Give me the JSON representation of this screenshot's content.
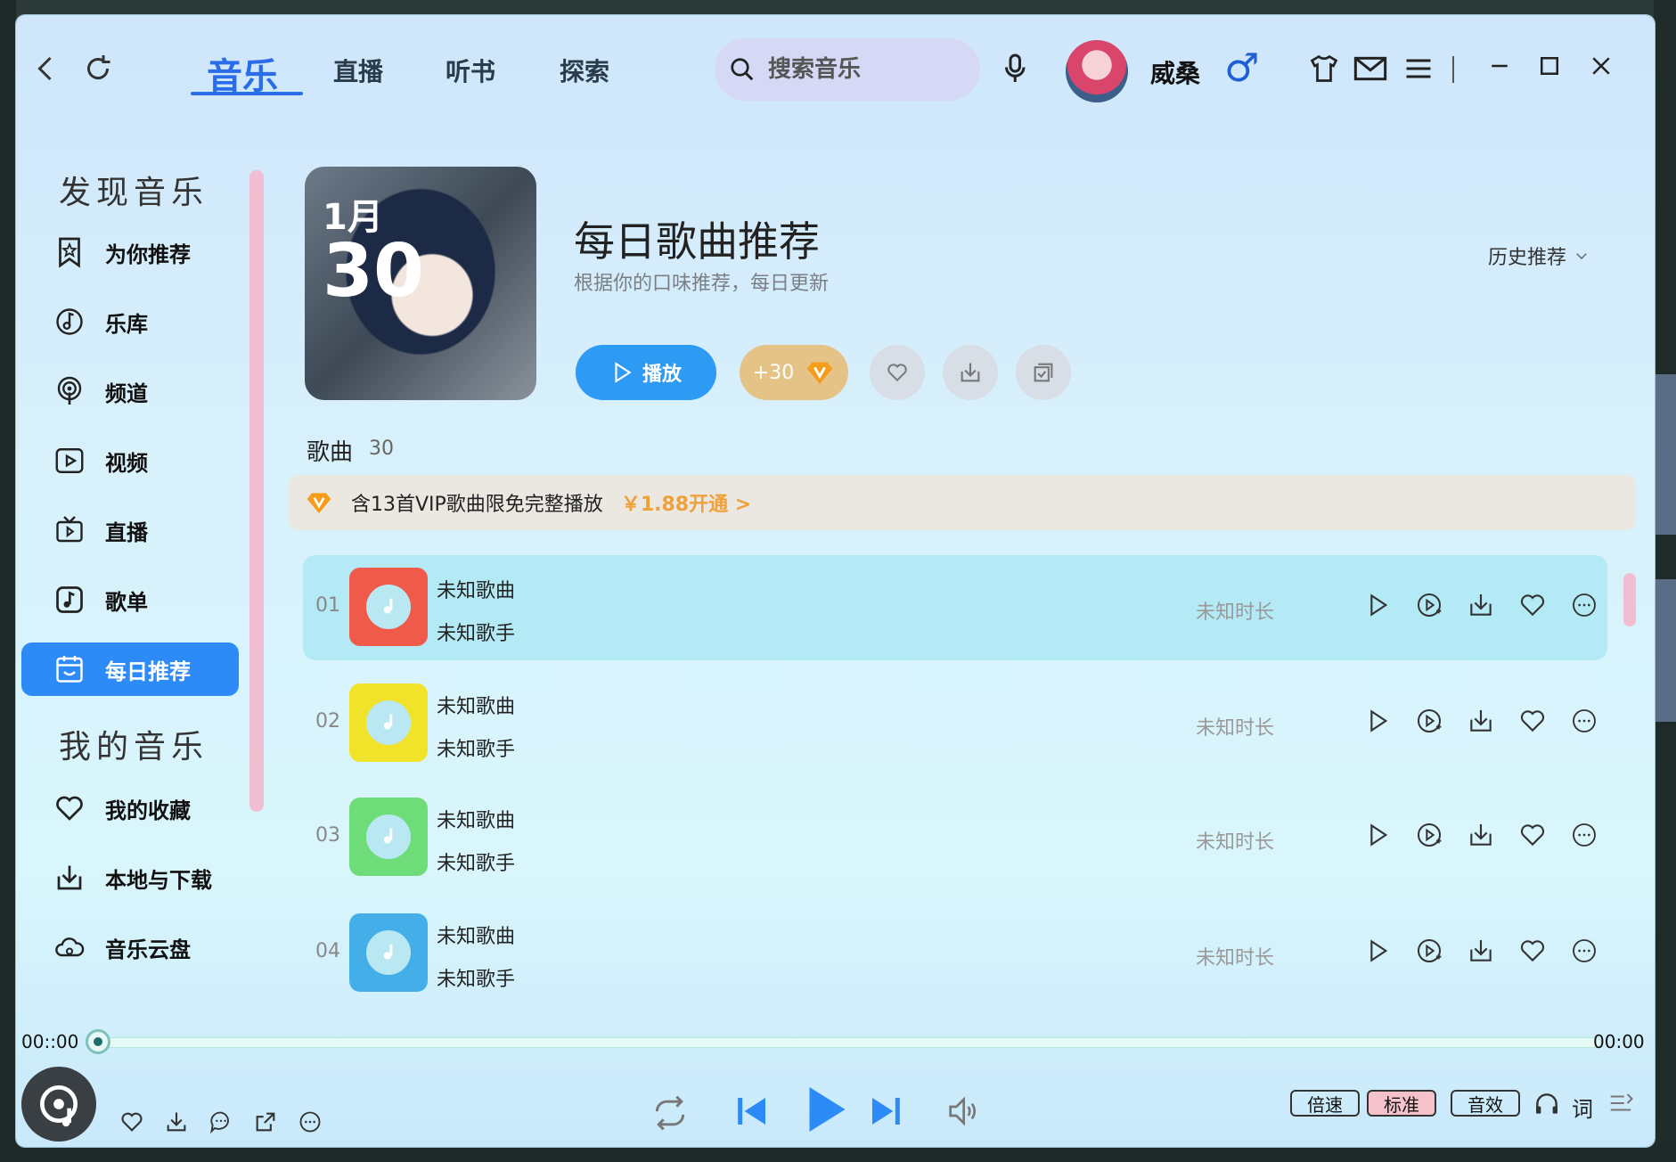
{
  "window": {
    "nav_tabs": [
      {
        "label": "音乐",
        "active": true
      },
      {
        "label": "直播",
        "active": false
      },
      {
        "label": "听书",
        "active": false
      },
      {
        "label": "探索",
        "active": false
      }
    ],
    "search_placeholder": "搜索音乐",
    "username": "威桑",
    "gender_symbol": "♂"
  },
  "sidebar": {
    "section_discover": "发现音乐",
    "section_mine": "我的音乐",
    "discover_items": [
      {
        "label": "为你推荐",
        "icon": "star-bookmark-icon"
      },
      {
        "label": "乐库",
        "icon": "music-library-icon"
      },
      {
        "label": "频道",
        "icon": "podcast-icon"
      },
      {
        "label": "视频",
        "icon": "video-icon"
      },
      {
        "label": "直播",
        "icon": "tv-icon"
      },
      {
        "label": "歌单",
        "icon": "playlist-icon"
      },
      {
        "label": "每日推荐",
        "icon": "calendar-icon",
        "active": true
      }
    ],
    "mine_items": [
      {
        "label": "我的收藏",
        "icon": "heart-icon"
      },
      {
        "label": "本地与下载",
        "icon": "download-icon"
      },
      {
        "label": "音乐云盘",
        "icon": "cloud-icon"
      }
    ]
  },
  "header": {
    "cover_month": "1月",
    "cover_day": "30",
    "title": "每日歌曲推荐",
    "subtitle": "根据你的口味推荐，每日更新",
    "history_label": "历史推荐",
    "play_label": "播放",
    "vip_label": "+30"
  },
  "songs": {
    "label": "歌曲",
    "count": "30",
    "vip_banner_text": "含13首VIP歌曲限免完整播放",
    "vip_banner_price": "￥1.88开通 >",
    "rows": [
      {
        "num": "01",
        "title": "未知歌曲",
        "artist": "未知歌手",
        "duration": "未知时长",
        "color": "#f05a4a"
      },
      {
        "num": "02",
        "title": "未知歌曲",
        "artist": "未知歌手",
        "duration": "未知时长",
        "color": "#f1e22a"
      },
      {
        "num": "03",
        "title": "未知歌曲",
        "artist": "未知歌手",
        "duration": "未知时长",
        "color": "#6fdc7a"
      },
      {
        "num": "04",
        "title": "未知歌曲",
        "artist": "未知歌手",
        "duration": "未知时长",
        "color": "#44aee8"
      }
    ]
  },
  "player": {
    "time_current": "00::00",
    "time_total": "00:00",
    "progress": 0,
    "speed_label": "倍速",
    "quality_label": "标准",
    "effect_label": "音效",
    "lyric_label": "词"
  },
  "colors": {
    "accent": "#2a6de8",
    "sidebar_active": "#2d8bf7",
    "play_button": "#2d9bf4",
    "vip_gold": "#e5c286",
    "active_row": "#b4eaf5"
  }
}
